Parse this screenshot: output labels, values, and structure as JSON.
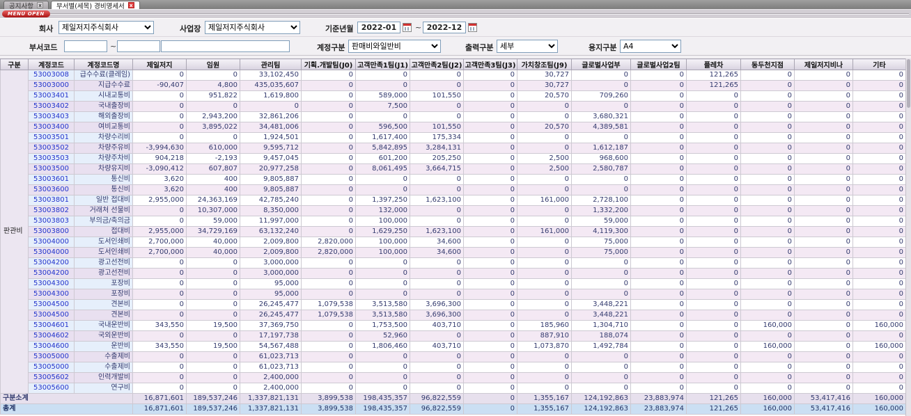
{
  "tabs": [
    {
      "label": "공지사항"
    },
    {
      "label": "부서별(세목) 경비명세서"
    }
  ],
  "menu": {
    "open_label": "MENU OPEN"
  },
  "filters": {
    "company_label": "회사",
    "company_value": "제일저지주식회사",
    "site_label": "사업장",
    "site_value": "제일저지주식회사",
    "period_label": "기준년월",
    "period_from": "2022-01",
    "period_to": "2022-12",
    "tilde": "~",
    "dept_label": "부서코드",
    "dept_from": "",
    "dept_to": "",
    "dept_name": "",
    "account_label": "계정구분",
    "account_value": "판매비와일반비",
    "output_label": "출력구분",
    "output_value": "세부",
    "paper_label": "용지구분",
    "paper_value": "A4"
  },
  "table": {
    "group_label": "판관비",
    "columns": [
      "구분",
      "계정코드",
      "계정코드명",
      "제일저지",
      "임원",
      "관리팀",
      "기획.개발팀(J0)",
      "고객만족1팀(J1)",
      "고객만족2팀(J2)",
      "고객만족3팀(J3)",
      "가치창조팀(J9)",
      "글로벌사업부",
      "글로벌사업2팀",
      "플레차",
      "동두천지점",
      "제일저지비나",
      "기타"
    ],
    "rows": [
      {
        "code": "53003008",
        "name": "급수수료(클레임)",
        "values": [
          "0",
          "0",
          "33,102,450",
          "0",
          "0",
          "0",
          "0",
          "30,727",
          "0",
          "0",
          "121,265",
          "0",
          "0",
          "0"
        ]
      },
      {
        "code": "53003000",
        "name": "지급수수료",
        "values": [
          "-90,407",
          "4,800",
          "435,035,607",
          "0",
          "0",
          "0",
          "0",
          "30,727",
          "0",
          "0",
          "121,265",
          "0",
          "0",
          "0"
        ]
      },
      {
        "code": "53003401",
        "name": "시내교통비",
        "values": [
          "0",
          "951,822",
          "1,619,800",
          "0",
          "589,000",
          "101,550",
          "0",
          "20,570",
          "709,260",
          "0",
          "0",
          "0",
          "0",
          "0"
        ]
      },
      {
        "code": "53003402",
        "name": "국내출장비",
        "values": [
          "0",
          "0",
          "0",
          "0",
          "7,500",
          "0",
          "0",
          "0",
          "0",
          "0",
          "0",
          "0",
          "0",
          "0"
        ]
      },
      {
        "code": "53003403",
        "name": "해외출장비",
        "values": [
          "0",
          "2,943,200",
          "32,861,206",
          "0",
          "0",
          "0",
          "0",
          "0",
          "3,680,321",
          "0",
          "0",
          "0",
          "0",
          "0"
        ]
      },
      {
        "code": "53003400",
        "name": "여비교통비",
        "values": [
          "0",
          "3,895,022",
          "34,481,006",
          "0",
          "596,500",
          "101,550",
          "0",
          "20,570",
          "4,389,581",
          "0",
          "0",
          "0",
          "0",
          "0"
        ]
      },
      {
        "code": "53003501",
        "name": "차량수리비",
        "values": [
          "0",
          "0",
          "1,924,501",
          "0",
          "1,617,400",
          "175,334",
          "0",
          "0",
          "0",
          "0",
          "0",
          "0",
          "0",
          "0"
        ]
      },
      {
        "code": "53003502",
        "name": "차량주유비",
        "values": [
          "-3,994,630",
          "610,000",
          "9,595,712",
          "0",
          "5,842,895",
          "3,284,131",
          "0",
          "0",
          "1,612,187",
          "0",
          "0",
          "0",
          "0",
          "0"
        ]
      },
      {
        "code": "53003503",
        "name": "차량주차비",
        "values": [
          "904,218",
          "-2,193",
          "9,457,045",
          "0",
          "601,200",
          "205,250",
          "0",
          "2,500",
          "968,600",
          "0",
          "0",
          "0",
          "0",
          "0"
        ]
      },
      {
        "code": "53003500",
        "name": "차량유지비",
        "values": [
          "-3,090,412",
          "607,807",
          "20,977,258",
          "0",
          "8,061,495",
          "3,664,715",
          "0",
          "2,500",
          "2,580,787",
          "0",
          "0",
          "0",
          "0",
          "0"
        ]
      },
      {
        "code": "53003601",
        "name": "통신비",
        "values": [
          "3,620",
          "400",
          "9,805,887",
          "0",
          "0",
          "0",
          "0",
          "0",
          "0",
          "0",
          "0",
          "0",
          "0",
          "0"
        ]
      },
      {
        "code": "53003600",
        "name": "통신비",
        "values": [
          "3,620",
          "400",
          "9,805,887",
          "0",
          "0",
          "0",
          "0",
          "0",
          "0",
          "0",
          "0",
          "0",
          "0",
          "0"
        ]
      },
      {
        "code": "53003801",
        "name": "일반 접대비",
        "values": [
          "2,955,000",
          "24,363,169",
          "42,785,240",
          "0",
          "1,397,250",
          "1,623,100",
          "0",
          "161,000",
          "2,728,100",
          "0",
          "0",
          "0",
          "0",
          "0"
        ]
      },
      {
        "code": "53003802",
        "name": "거래처 선물비",
        "values": [
          "0",
          "10,307,000",
          "8,350,000",
          "0",
          "132,000",
          "0",
          "0",
          "0",
          "1,332,200",
          "0",
          "0",
          "0",
          "0",
          "0"
        ]
      },
      {
        "code": "53003803",
        "name": "부의금/축의금",
        "values": [
          "0",
          "59,000",
          "11,997,000",
          "0",
          "100,000",
          "0",
          "0",
          "0",
          "59,000",
          "0",
          "0",
          "0",
          "0",
          "0"
        ]
      },
      {
        "code": "53003800",
        "name": "접대비",
        "values": [
          "2,955,000",
          "34,729,169",
          "63,132,240",
          "0",
          "1,629,250",
          "1,623,100",
          "0",
          "161,000",
          "4,119,300",
          "0",
          "0",
          "0",
          "0",
          "0"
        ]
      },
      {
        "code": "53004000",
        "name": "도서인쇄비",
        "values": [
          "2,700,000",
          "40,000",
          "2,009,800",
          "2,820,000",
          "100,000",
          "34,600",
          "0",
          "0",
          "75,000",
          "0",
          "0",
          "0",
          "0",
          "0"
        ]
      },
      {
        "code": "53004000",
        "name": "도서인쇄비",
        "values": [
          "2,700,000",
          "40,000",
          "2,009,800",
          "2,820,000",
          "100,000",
          "34,600",
          "0",
          "0",
          "75,000",
          "0",
          "0",
          "0",
          "0",
          "0"
        ]
      },
      {
        "code": "53004200",
        "name": "광고선전비",
        "values": [
          "0",
          "0",
          "3,000,000",
          "0",
          "0",
          "0",
          "0",
          "0",
          "0",
          "0",
          "0",
          "0",
          "0",
          "0"
        ]
      },
      {
        "code": "53004200",
        "name": "광고선전비",
        "values": [
          "0",
          "0",
          "3,000,000",
          "0",
          "0",
          "0",
          "0",
          "0",
          "0",
          "0",
          "0",
          "0",
          "0",
          "0"
        ]
      },
      {
        "code": "53004300",
        "name": "포장비",
        "values": [
          "0",
          "0",
          "95,000",
          "0",
          "0",
          "0",
          "0",
          "0",
          "0",
          "0",
          "0",
          "0",
          "0",
          "0"
        ]
      },
      {
        "code": "53004300",
        "name": "포장비",
        "values": [
          "0",
          "0",
          "95,000",
          "0",
          "0",
          "0",
          "0",
          "0",
          "0",
          "0",
          "0",
          "0",
          "0",
          "0"
        ]
      },
      {
        "code": "53004500",
        "name": "견본비",
        "values": [
          "0",
          "0",
          "26,245,477",
          "1,079,538",
          "3,513,580",
          "3,696,300",
          "0",
          "0",
          "3,448,221",
          "0",
          "0",
          "0",
          "0",
          "0"
        ]
      },
      {
        "code": "53004500",
        "name": "견본비",
        "values": [
          "0",
          "0",
          "26,245,477",
          "1,079,538",
          "3,513,580",
          "3,696,300",
          "0",
          "0",
          "3,448,221",
          "0",
          "0",
          "0",
          "0",
          "0"
        ]
      },
      {
        "code": "53004601",
        "name": "국내운반비",
        "values": [
          "343,550",
          "19,500",
          "37,369,750",
          "0",
          "1,753,500",
          "403,710",
          "0",
          "185,960",
          "1,304,710",
          "0",
          "0",
          "160,000",
          "0",
          "160,000"
        ]
      },
      {
        "code": "53004602",
        "name": "국외운반비",
        "values": [
          "0",
          "0",
          "17,197,738",
          "0",
          "52,960",
          "0",
          "0",
          "887,910",
          "188,074",
          "0",
          "0",
          "0",
          "0",
          "0"
        ]
      },
      {
        "code": "53004600",
        "name": "운반비",
        "values": [
          "343,550",
          "19,500",
          "54,567,488",
          "0",
          "1,806,460",
          "403,710",
          "0",
          "1,073,870",
          "1,492,784",
          "0",
          "0",
          "160,000",
          "0",
          "160,000"
        ]
      },
      {
        "code": "53005000",
        "name": "수출제비",
        "values": [
          "0",
          "0",
          "61,023,713",
          "0",
          "0",
          "0",
          "0",
          "0",
          "0",
          "0",
          "0",
          "0",
          "0",
          "0"
        ]
      },
      {
        "code": "53005000",
        "name": "수출제비",
        "values": [
          "0",
          "0",
          "61,023,713",
          "0",
          "0",
          "0",
          "0",
          "0",
          "0",
          "0",
          "0",
          "0",
          "0",
          "0"
        ]
      },
      {
        "code": "53005602",
        "name": "인력개발비",
        "values": [
          "0",
          "0",
          "2,400,000",
          "0",
          "0",
          "0",
          "0",
          "0",
          "0",
          "0",
          "0",
          "0",
          "0",
          "0"
        ]
      },
      {
        "code": "53005600",
        "name": "연구비",
        "values": [
          "0",
          "0",
          "2,400,000",
          "0",
          "0",
          "0",
          "0",
          "0",
          "0",
          "0",
          "0",
          "0",
          "0",
          "0"
        ]
      }
    ],
    "subtotal": {
      "label": "구분소계",
      "values": [
        "16,871,601",
        "189,537,246",
        "1,337,821,131",
        "3,899,538",
        "198,435,357",
        "96,822,559",
        "0",
        "1,355,167",
        "124,192,863",
        "23,883,974",
        "121,265",
        "160,000",
        "53,417,416",
        "160,000"
      ]
    },
    "total": {
      "label": "총계",
      "values": [
        "16,871,601",
        "189,537,246",
        "1,337,821,131",
        "3,899,538",
        "198,435,357",
        "96,822,559",
        "0",
        "1,355,167",
        "124,192,863",
        "23,883,974",
        "121,265",
        "160,000",
        "53,417,416",
        "160,000"
      ]
    }
  }
}
